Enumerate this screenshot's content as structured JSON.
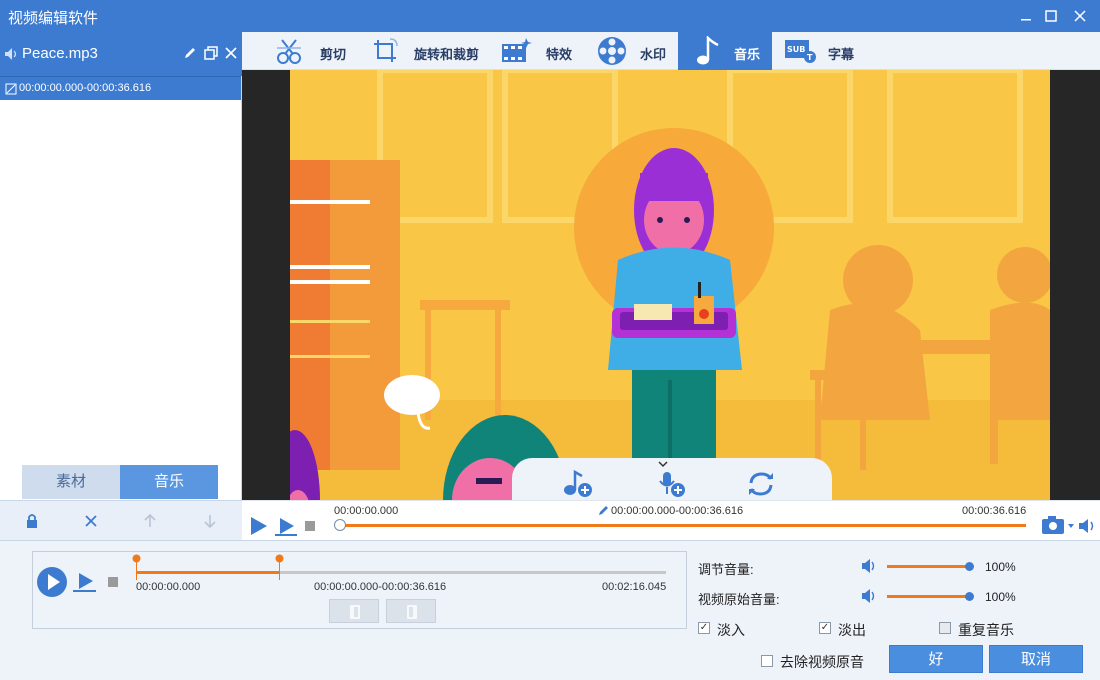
{
  "window": {
    "title": "视频编辑软件",
    "controls": [
      "minimize-icon",
      "maximize-icon",
      "close-icon"
    ]
  },
  "left_panel": {
    "file_name": "Peace.mp3",
    "clip_range": "00:00:00.000-00:00:36.616",
    "tabs": [
      {
        "label": "素材",
        "active": false
      },
      {
        "label": "音乐",
        "active": true
      }
    ],
    "tool_icons": [
      "lock-icon",
      "delete-icon",
      "move-up-icon",
      "move-down-icon"
    ]
  },
  "toolbar": {
    "items": [
      {
        "label": "剪切",
        "icon": "cut-icon",
        "active": false
      },
      {
        "label": "旋转和裁剪",
        "icon": "rotate-crop-icon",
        "active": false
      },
      {
        "label": "特效",
        "icon": "effects-icon",
        "active": false
      },
      {
        "label": "水印",
        "icon": "watermark-icon",
        "active": false
      },
      {
        "label": "音乐",
        "icon": "music-icon",
        "active": true
      },
      {
        "label": "字幕",
        "icon": "subtitle-icon",
        "active": false
      }
    ]
  },
  "preview": {
    "overlay_icons": [
      "add-music-icon",
      "add-voiceover-icon",
      "refresh-icon"
    ]
  },
  "playback": {
    "start_time": "00:00:00.000",
    "range": "00:00:00.000-00:00:36.616",
    "end_time": "00:00:36.616",
    "progress": 0.0
  },
  "trim": {
    "start_label": "00:00:00.000",
    "range_label": "00:00:00.000-00:00:36.616",
    "end_label": "00:02:16.045",
    "selection_start": 0.0,
    "selection_end": 0.27
  },
  "audio": {
    "volume_label": "调节音量:",
    "volume_value": "100%",
    "original_volume_label": "视频原始音量:",
    "original_volume_value": "100%",
    "fade_in": {
      "label": "淡入",
      "checked": true
    },
    "fade_out": {
      "label": "淡出",
      "checked": true
    },
    "repeat": {
      "label": "重复音乐",
      "checked": false
    }
  },
  "footer": {
    "remove_original_label": "去除视频原音",
    "remove_original_checked": false,
    "ok_label": "好",
    "cancel_label": "取消"
  },
  "colors": {
    "accent": "#3d7bd0",
    "timeline": "#f07a1a",
    "video_bg": "#f9c646"
  }
}
